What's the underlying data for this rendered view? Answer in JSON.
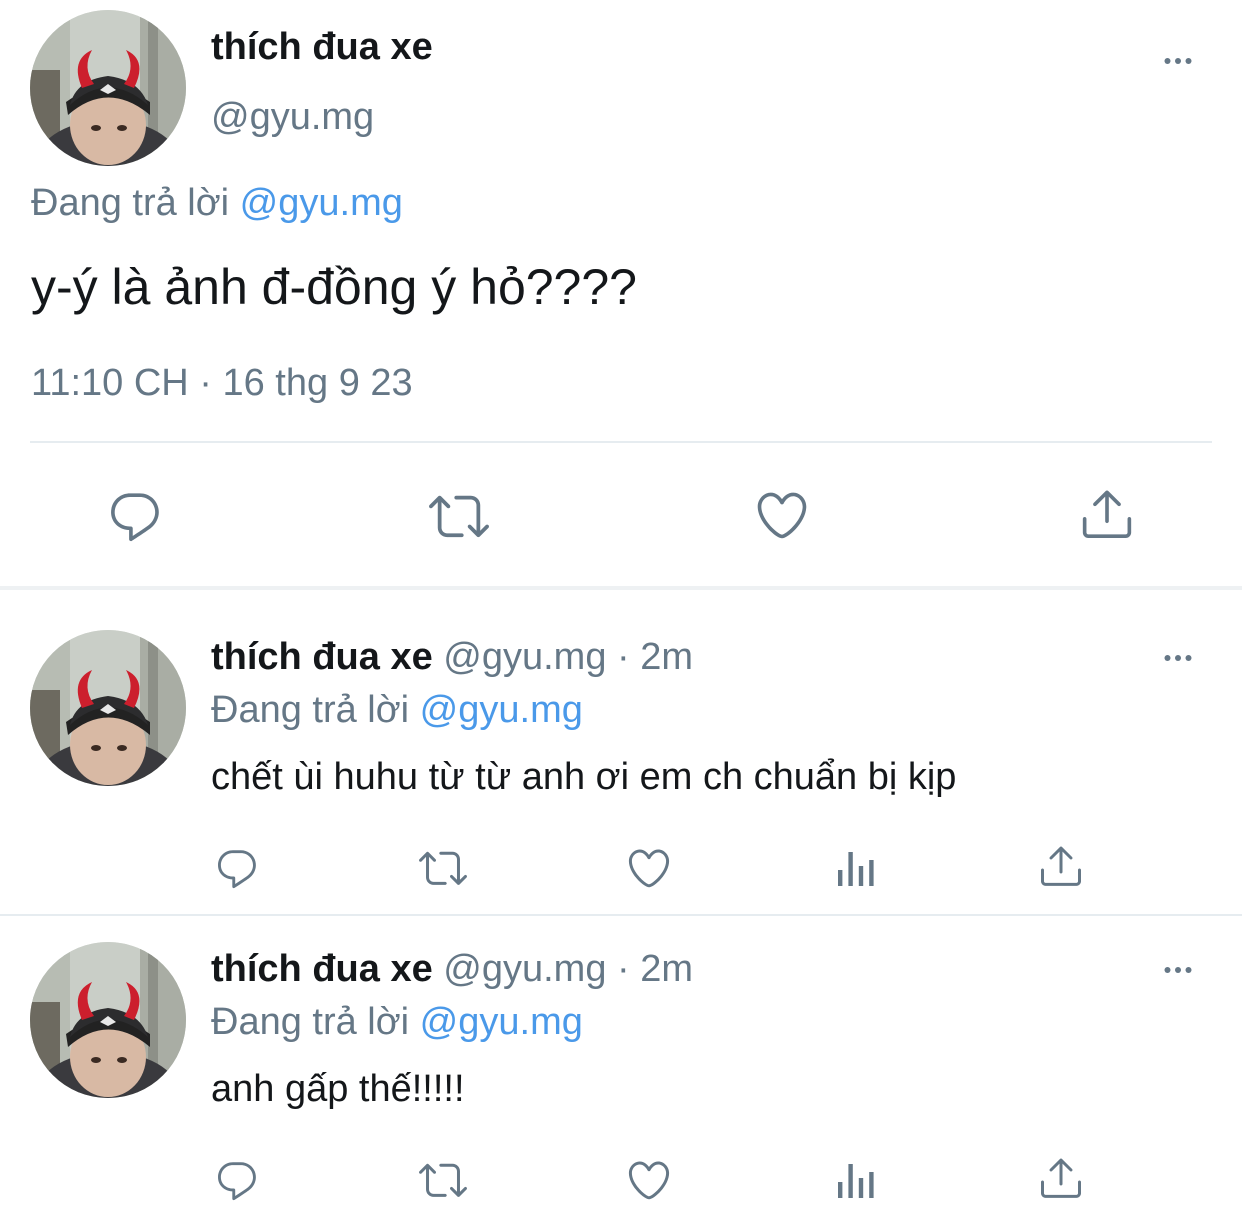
{
  "main_tweet": {
    "display_name": "thích đua xe",
    "handle": "@gyu.mg",
    "replying_prefix": "Đang trả lời",
    "replying_to": "@gyu.mg",
    "text": "y-ý là ảnh đ-đồng ý hỏ????",
    "timestamp": "11:10 CH · 16 thg 9 23",
    "actions": [
      "reply-icon",
      "retweet-icon",
      "like-icon",
      "share-icon"
    ],
    "more_icon": "more-horizontal-icon"
  },
  "replies": [
    {
      "display_name": "thích đua xe",
      "handle": "@gyu.mg",
      "separator": "·",
      "time": "2m",
      "replying_prefix": "Đang trả lời",
      "replying_to": "@gyu.mg",
      "text": "chết ùi huhu từ từ anh ơi em ch chuẩn bị kịp",
      "actions": [
        "reply-icon",
        "retweet-icon",
        "like-icon",
        "analytics-icon",
        "share-icon"
      ]
    },
    {
      "display_name": "thích đua xe",
      "handle": "@gyu.mg",
      "separator": "·",
      "time": "2m",
      "replying_prefix": "Đang trả lời",
      "replying_to": "@gyu.mg",
      "text": "anh gấp thế!!!!!",
      "actions": [
        "reply-icon",
        "retweet-icon",
        "like-icon",
        "analytics-icon",
        "share-icon"
      ]
    }
  ],
  "colors": {
    "text": "#14171a",
    "muted": "#657786",
    "link": "#4a99e9",
    "divider": "#e6ecf0"
  }
}
